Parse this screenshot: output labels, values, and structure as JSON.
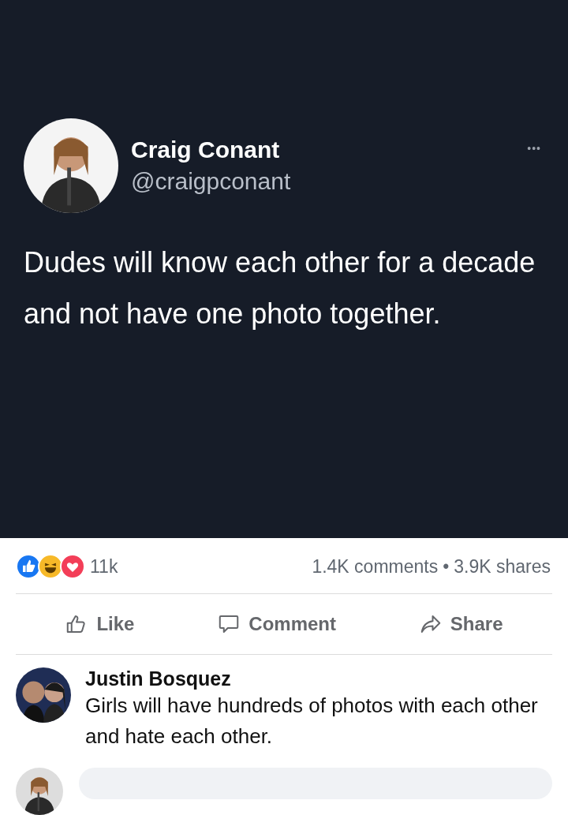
{
  "tweet": {
    "author": "Craig Conant",
    "handle": "@craigpconant",
    "menu": "•••",
    "text": "Dudes will know each other for a decade and not have one photo together."
  },
  "reactions": {
    "icons": [
      {
        "kind": "like",
        "color": "#1877f2"
      },
      {
        "kind": "haha",
        "color": "#f7b928"
      },
      {
        "kind": "love",
        "color": "#f33e58"
      }
    ],
    "count": "11k",
    "comments": "1.4K comments",
    "separator": "•",
    "shares": "3.9K shares"
  },
  "actions": [
    {
      "kind": "like",
      "label": "Like"
    },
    {
      "kind": "comment",
      "label": "Comment"
    },
    {
      "kind": "share",
      "label": "Share"
    }
  ],
  "comments": [
    {
      "author": "Justin Bosquez",
      "text": "Girls will have hundreds of photos with each other and hate each other."
    }
  ]
}
